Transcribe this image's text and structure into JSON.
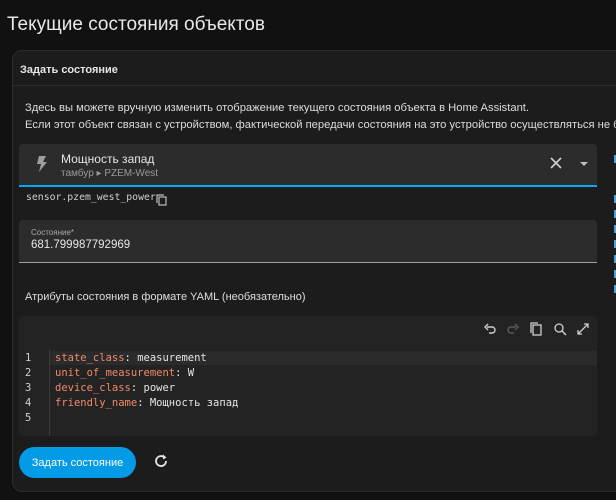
{
  "page": {
    "title": "Текущие состояния объектов"
  },
  "card": {
    "title": "Задать состояние",
    "description_line1": "Здесь вы можете вручную изменить отображение текущего состояния объекта в Home Assistant.",
    "description_line2": "Если этот объект связан с устройством, фактической передачи состояния на это устройство осуществляться не буде"
  },
  "entity_picker": {
    "name": "Мощность запад",
    "path": "тамбур ▸ PZEM-West",
    "icon": "flash-icon",
    "entity_id": "sensor.pzem_west_power"
  },
  "state_field": {
    "label": "Состояние*",
    "value": "681.799987792969"
  },
  "yaml": {
    "title": "Атрибуты состояния в формате YAML (необязательно)",
    "line_numbers": [
      "1",
      "2",
      "3",
      "4",
      "5"
    ],
    "lines": [
      {
        "key": "state_class",
        "sep": ": ",
        "value": "measurement"
      },
      {
        "key": "unit_of_measurement",
        "sep": ": ",
        "value": "W"
      },
      {
        "key": "device_class",
        "sep": ": ",
        "value": "power"
      },
      {
        "key": "friendly_name",
        "sep": ": ",
        "value": "Мощность запад"
      },
      {
        "key": "",
        "sep": "",
        "value": ""
      }
    ]
  },
  "actions": {
    "submit_label": "Задать состояние"
  },
  "colors": {
    "accent": "#03a9f4",
    "button": "#039be5",
    "yaml_key": "#f08a6a"
  }
}
